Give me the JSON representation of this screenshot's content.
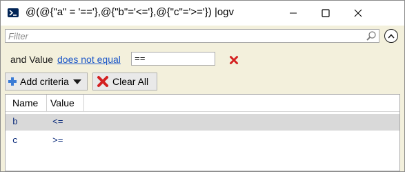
{
  "window": {
    "title": "@(@{\"a\" = '=='},@{\"b\"='<='},@{\"c\"='>='}) |ogv",
    "controls": [
      "minimize",
      "maximize",
      "close"
    ]
  },
  "filter": {
    "placeholder": "Filter",
    "value": ""
  },
  "criteria": [
    {
      "prefix": "and Value",
      "operator": "does not equal",
      "value": "=="
    }
  ],
  "toolbar": {
    "add_label": "Add criteria",
    "clear_label": "Clear All"
  },
  "grid": {
    "columns": [
      "Name",
      "Value"
    ],
    "rows": [
      {
        "name": "b",
        "value": "<=",
        "selected": true
      },
      {
        "name": "c",
        "value": ">=",
        "selected": false
      }
    ]
  },
  "colors": {
    "panel": "#f3f0dc",
    "link": "#1a56c8",
    "remove": "#d42020",
    "selected_row": "#d9d9d9"
  }
}
